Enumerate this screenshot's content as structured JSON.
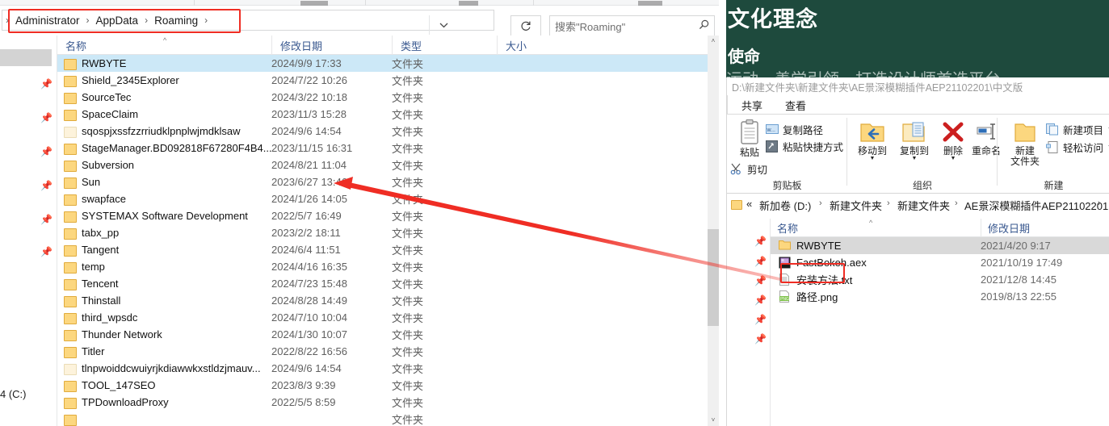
{
  "left_window": {
    "address": {
      "crumbs": [
        "Administrator",
        "AppData",
        "Roaming"
      ],
      "separator": "›",
      "leading_separator": "›",
      "dropdown_icon": "chevron-down-icon",
      "refresh_icon": "↻"
    },
    "search": {
      "placeholder": "搜索\"Roaming\"",
      "icon": "search-icon"
    },
    "nav": {
      "partial_drive_label": "4 (C:)",
      "pin_icon": "pin-icon",
      "pin_count": 6
    },
    "columns": [
      {
        "label": "名称",
        "sorted": true
      },
      {
        "label": "修改日期",
        "sorted": false
      },
      {
        "label": "类型",
        "sorted": false
      },
      {
        "label": "大小",
        "sorted": false
      }
    ],
    "sort_caret": "^",
    "rows": [
      {
        "name": "RWBYTE",
        "date": "2024/9/9 17:33",
        "type": "文件夹",
        "selected": true,
        "pale": false
      },
      {
        "name": "Shield_2345Explorer",
        "date": "2024/7/22 10:26",
        "type": "文件夹",
        "selected": false,
        "pale": false
      },
      {
        "name": "SourceTec",
        "date": "2024/3/22 10:18",
        "type": "文件夹",
        "selected": false,
        "pale": false
      },
      {
        "name": "SpaceClaim",
        "date": "2023/11/3 15:28",
        "type": "文件夹",
        "selected": false,
        "pale": false
      },
      {
        "name": "sqospjxssfzzrriudklpnplwjmdklsaw",
        "date": "2024/9/6 14:54",
        "type": "文件夹",
        "selected": false,
        "pale": true
      },
      {
        "name": "StageManager.BD092818F67280F4B4...",
        "date": "2023/11/15 16:31",
        "type": "文件夹",
        "selected": false,
        "pale": false
      },
      {
        "name": "Subversion",
        "date": "2024/8/21 11:04",
        "type": "文件夹",
        "selected": false,
        "pale": false
      },
      {
        "name": "Sun",
        "date": "2023/6/27 13:46",
        "type": "文件夹",
        "selected": false,
        "pale": false
      },
      {
        "name": "swapface",
        "date": "2024/1/26 14:05",
        "type": "文件夹",
        "selected": false,
        "pale": false
      },
      {
        "name": "SYSTEMAX Software Development",
        "date": "2022/5/7 16:49",
        "type": "文件夹",
        "selected": false,
        "pale": false
      },
      {
        "name": "tabx_pp",
        "date": "2023/2/2 18:11",
        "type": "文件夹",
        "selected": false,
        "pale": false
      },
      {
        "name": "Tangent",
        "date": "2024/6/4 11:51",
        "type": "文件夹",
        "selected": false,
        "pale": false
      },
      {
        "name": "temp",
        "date": "2024/4/16 16:35",
        "type": "文件夹",
        "selected": false,
        "pale": false
      },
      {
        "name": "Tencent",
        "date": "2024/7/23 15:48",
        "type": "文件夹",
        "selected": false,
        "pale": false
      },
      {
        "name": "Thinstall",
        "date": "2024/8/28 14:49",
        "type": "文件夹",
        "selected": false,
        "pale": false
      },
      {
        "name": "third_wpsdc",
        "date": "2024/7/10 10:04",
        "type": "文件夹",
        "selected": false,
        "pale": false
      },
      {
        "name": "Thunder Network",
        "date": "2024/1/30 10:07",
        "type": "文件夹",
        "selected": false,
        "pale": false
      },
      {
        "name": "Titler",
        "date": "2022/8/22 16:56",
        "type": "文件夹",
        "selected": false,
        "pale": false
      },
      {
        "name": "tlnpwoiddcwuiyrjkdiawwkxstldzjmauv...",
        "date": "2024/9/6 14:54",
        "type": "文件夹",
        "selected": false,
        "pale": true
      },
      {
        "name": "TOOL_147SEO",
        "date": "2023/8/3 9:39",
        "type": "文件夹",
        "selected": false,
        "pale": false
      },
      {
        "name": "TPDownloadProxy",
        "date": "2022/5/5 8:59",
        "type": "文件夹",
        "selected": false,
        "pale": false
      },
      {
        "name": "",
        "date": "",
        "type": "文件夹",
        "selected": false,
        "pale": false
      }
    ],
    "scrollbar": {
      "up_arrow": "˄",
      "down_arrow": "˅"
    }
  },
  "background_page": {
    "title": "文化理念",
    "subtitle": "使命",
    "body": "运动、善学引领，打造设计师首选平台"
  },
  "right_window": {
    "title_path": "D:\\新建文件夹\\新建文件夹\\AE景深模糊插件AEP21102201\\中文版",
    "tabs": [
      {
        "label": "共享"
      },
      {
        "label": "查看"
      }
    ],
    "ribbon": {
      "groups": [
        {
          "label": "剪贴板",
          "big_buttons": [
            {
              "caption": "粘贴",
              "icon": "clipboard-icon"
            }
          ],
          "small_buttons": [
            {
              "label": "复制路径",
              "icon": "copy-path-icon"
            },
            {
              "label": "粘贴快捷方式",
              "icon": "paste-shortcut-icon"
            },
            {
              "label": "剪切",
              "icon": "scissors-icon"
            }
          ]
        },
        {
          "label": "组织",
          "big_buttons": [
            {
              "caption": "移动到",
              "icon": "move-to-icon",
              "has_dropdown": true
            },
            {
              "caption": "复制到",
              "icon": "copy-to-icon",
              "has_dropdown": true
            },
            {
              "caption": "删除",
              "icon": "delete-x-icon",
              "has_dropdown": true
            },
            {
              "caption": "重命名",
              "icon": "rename-icon",
              "has_dropdown": false
            }
          ],
          "small_buttons": []
        },
        {
          "label": "新建",
          "big_buttons": [
            {
              "caption": "新建\n文件夹",
              "icon": "new-folder-icon"
            }
          ],
          "small_buttons": [
            {
              "label": "新建项目",
              "icon": "new-item-icon",
              "has_dropdown": true
            },
            {
              "label": "轻松访问",
              "icon": "easy-access-icon",
              "has_dropdown": true
            }
          ]
        }
      ]
    },
    "address": {
      "back_chevrons": "«",
      "crumbs": [
        "新加卷 (D:)",
        "新建文件夹",
        "新建文件夹",
        "AE景深模糊插件AEP21102201"
      ],
      "separator": "›",
      "folder_icon": "folder-icon"
    },
    "columns": [
      {
        "label": "名称"
      },
      {
        "label": "修改日期"
      }
    ],
    "sort_caret": "^",
    "nav": {
      "pin_icon": "pin-icon",
      "pin_count": 6
    },
    "rows": [
      {
        "name": "RWBYTE",
        "date": "2021/4/20 9:17",
        "icon": "folder-icon",
        "selected": true
      },
      {
        "name": "FastBokeh.aex",
        "date": "2021/10/19 17:49",
        "icon": "aex-file-icon",
        "selected": false
      },
      {
        "name": "安装方法.txt",
        "date": "2021/12/8 14:45",
        "icon": "txt-file-icon",
        "selected": false
      },
      {
        "name": "路径.png",
        "date": "2019/8/13 22:55",
        "icon": "png-file-icon",
        "selected": false
      }
    ]
  },
  "annotations": {
    "highlight_color": "#ef2d24",
    "boxes": [
      {
        "name": "breadcrumb-highlight"
      },
      {
        "name": "rwbyte-highlight"
      }
    ],
    "arrow": {
      "name": "pointer-arrow",
      "color": "#ef2d24"
    }
  }
}
